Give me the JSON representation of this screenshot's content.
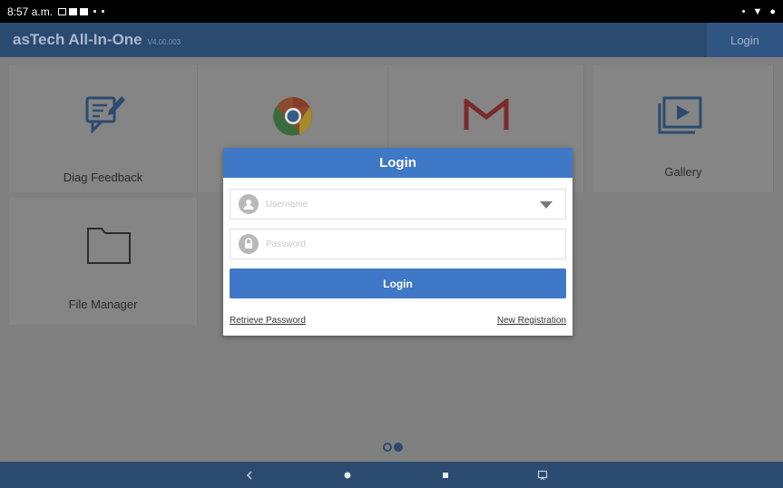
{
  "status_bar": {
    "time": "8:57 a.m."
  },
  "app_bar": {
    "title": "asTech All-In-One",
    "version": "V4.00.003",
    "login_label": "Login"
  },
  "tiles": [
    {
      "label": "Diag Feedback",
      "icon": "feedback-icon"
    },
    {
      "label": "",
      "icon": "chrome-icon"
    },
    {
      "label": "",
      "icon": "gmail-icon"
    },
    {
      "label": "Gallery",
      "icon": "gallery-icon"
    },
    {
      "label": "File Manager",
      "icon": "folder-icon"
    }
  ],
  "dialog": {
    "title": "Login",
    "username_placeholder": "Username",
    "password_placeholder": "Password",
    "login_button": "Login",
    "retrieve_password": "Retrieve Password",
    "new_registration": "New Registration"
  },
  "pager": {
    "current_page": 2,
    "total_pages": 2
  },
  "colors": {
    "app_bar": "#2a4a70",
    "dialog_accent": "#3f78c6",
    "scrim": "#808080"
  }
}
